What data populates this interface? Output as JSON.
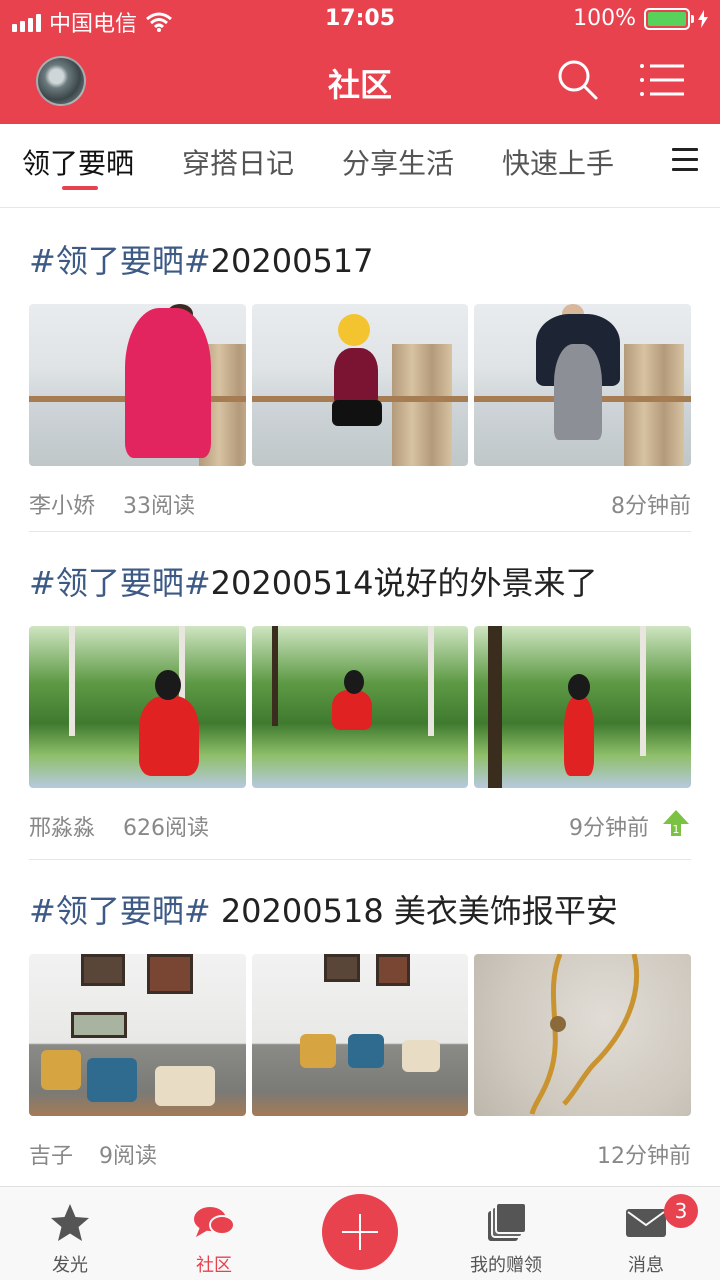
{
  "status_bar": {
    "carrier": "中国电信",
    "time": "17:05",
    "battery_percent": "100%"
  },
  "nav": {
    "title": "社区",
    "accent_color": "#e8424f"
  },
  "tabs": [
    {
      "label": "领了要晒",
      "active": true
    },
    {
      "label": "穿搭日记",
      "active": false
    },
    {
      "label": "分享生活",
      "active": false
    },
    {
      "label": "快速上手",
      "active": false
    }
  ],
  "posts": [
    {
      "tag": "#领了要晒#",
      "title_rest": "20200517",
      "author": "李小娇",
      "reads": "33阅读",
      "time": "8分钟前"
    },
    {
      "tag": "#领了要晒#",
      "title_rest": "20200514说好的外景来了",
      "author": "邢淼淼",
      "reads": "626阅读",
      "time": "9分钟前",
      "badge_icon": "up-arrow-icon"
    },
    {
      "tag": "#领了要晒#",
      "title_rest": " 20200518  美衣美饰报平安",
      "author": "吉子",
      "reads": "9阅读",
      "time": "12分钟前"
    }
  ],
  "bottom_tabs": [
    {
      "label": "发光",
      "icon": "star-icon"
    },
    {
      "label": "社区",
      "icon": "chat-bubbles-icon",
      "active": true
    },
    {
      "label": "",
      "icon": "plus-icon"
    },
    {
      "label": "我的赠领",
      "icon": "stack-icon"
    },
    {
      "label": "消息",
      "icon": "mail-icon"
    }
  ],
  "messages_badge": "3"
}
